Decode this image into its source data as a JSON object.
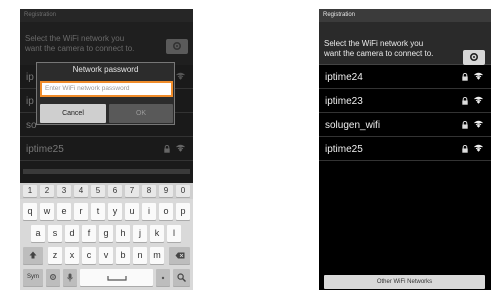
{
  "left_screen": {
    "title": "Registration",
    "header_text": [
      "Select the WiFi network you",
      "want the camera to connect to."
    ],
    "networks_partial": [
      "ip",
      "ip",
      "so",
      "iptime25"
    ],
    "dialog": {
      "title": "Network password",
      "placeholder": "Enter WiFi network password",
      "cancel": "Cancel",
      "ok": "OK"
    },
    "keyboard": {
      "numbers": [
        "1",
        "2",
        "3",
        "4",
        "5",
        "6",
        "7",
        "8",
        "9",
        "0"
      ],
      "row1": [
        "q",
        "w",
        "e",
        "r",
        "t",
        "y",
        "u",
        "i",
        "o",
        "p"
      ],
      "row2": [
        "a",
        "s",
        "d",
        "f",
        "g",
        "h",
        "j",
        "k",
        "l"
      ],
      "row3": [
        "z",
        "x",
        "c",
        "v",
        "b",
        "n",
        "m"
      ],
      "sym": "Sym"
    }
  },
  "right_screen": {
    "title": "Registration",
    "header_text": [
      "Select the WiFi network you",
      "want the camera to connect to."
    ],
    "networks": [
      "iptime24",
      "iptime23",
      "solugen_wifi",
      "iptime25"
    ],
    "other_button": "Other WiFi Networks"
  },
  "colors": {
    "accent_orange": "#f08c2a"
  }
}
